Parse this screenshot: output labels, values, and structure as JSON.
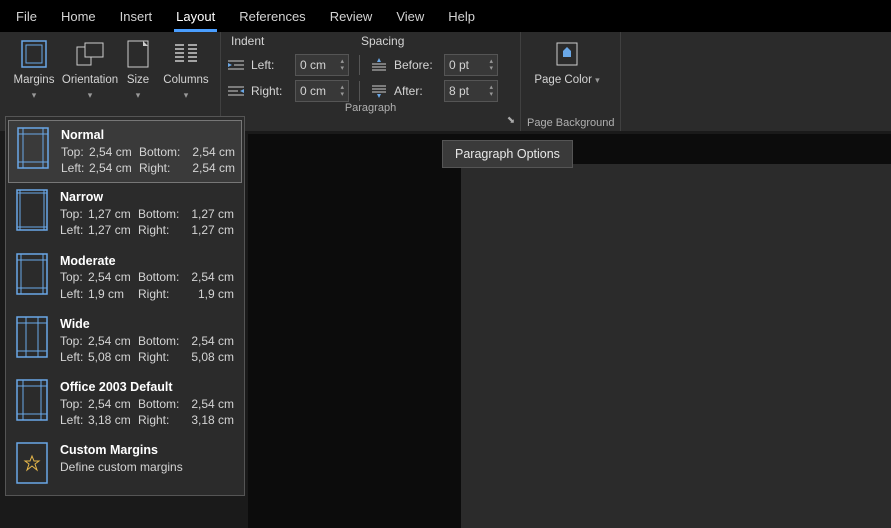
{
  "tabs": {
    "file": "File",
    "home": "Home",
    "insert": "Insert",
    "layout": "Layout",
    "references": "References",
    "review": "Review",
    "view": "View",
    "help": "Help"
  },
  "ribbon": {
    "margins": "Margins",
    "orientation": "Orientation",
    "size": "Size",
    "columns": "Columns",
    "indent_header": "Indent",
    "spacing_header": "Spacing",
    "left_label": "Left:",
    "right_label": "Right:",
    "before_label": "Before:",
    "after_label": "After:",
    "left_value": "0 cm",
    "right_value": "0 cm",
    "before_value": "0 pt",
    "after_value": "8 pt",
    "paragraph_group": "Paragraph",
    "page_color": "Page Color",
    "page_bg_group": "Page Background"
  },
  "tooltip": "Paragraph Options",
  "margins_menu": [
    {
      "title": "Normal",
      "top": "2,54 cm",
      "bottom": "2,54 cm",
      "left": "2,54 cm",
      "right": "2,54 cm",
      "selected": true,
      "icon": "normal"
    },
    {
      "title": "Narrow",
      "top": "1,27 cm",
      "bottom": "1,27 cm",
      "left": "1,27 cm",
      "right": "1,27 cm",
      "icon": "narrow"
    },
    {
      "title": "Moderate",
      "top": "2,54 cm",
      "bottom": "2,54 cm",
      "left": "1,9 cm",
      "right": "1,9 cm",
      "icon": "moderate"
    },
    {
      "title": "Wide",
      "top": "2,54 cm",
      "bottom": "2,54 cm",
      "left": "5,08 cm",
      "right": "5,08 cm",
      "icon": "wide"
    },
    {
      "title": "Office 2003 Default",
      "top": "2,54 cm",
      "bottom": "2,54 cm",
      "left": "3,18 cm",
      "right": "3,18 cm",
      "icon": "o2003"
    },
    {
      "title": "Custom Margins",
      "subtitle": "Define custom margins",
      "icon": "custom"
    }
  ],
  "labels": {
    "top": "Top:",
    "bottom": "Bottom:",
    "left": "Left:",
    "right": "Right:"
  }
}
